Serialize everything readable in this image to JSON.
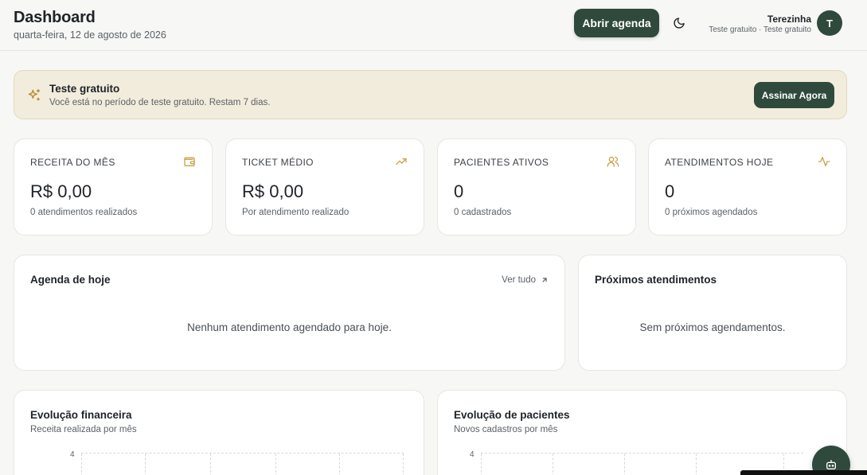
{
  "header": {
    "title": "Dashboard",
    "date": "quarta-feira, 12 de agosto de 2026",
    "agenda_button": "Abrir agenda",
    "theme_icon": "moon-icon",
    "user": {
      "name": "Terezinha",
      "plan": "Teste gratuito · Teste gratuito",
      "initial": "T"
    }
  },
  "trial_banner": {
    "icon": "sparkles-icon",
    "title": "Teste gratuito",
    "text": "Você está no período de teste gratuito. Restam 7 dias.",
    "button": "Assinar Agora"
  },
  "stats": [
    {
      "label": "RECEITA DO MÊS",
      "value": "R$ 0,00",
      "sub": "0 atendimentos realizados",
      "icon": "wallet-icon"
    },
    {
      "label": "TICKET MÉDIO",
      "value": "R$ 0,00",
      "sub": "Por atendimento realizado",
      "icon": "trending-up-icon"
    },
    {
      "label": "PACIENTES ATIVOS",
      "value": "0",
      "sub": "0 cadastrados",
      "icon": "users-icon"
    },
    {
      "label": "ATENDIMENTOS HOJE",
      "value": "0",
      "sub": "0 próximos agendados",
      "icon": "activity-icon"
    }
  ],
  "agenda_hoje": {
    "title": "Agenda de hoje",
    "link": "Ver tudo",
    "empty": "Nenhum atendimento agendado para hoje."
  },
  "proximos": {
    "title": "Próximos atendimentos",
    "empty": "Sem próximos agendamentos."
  },
  "evolucao_financeira": {
    "title": "Evolução financeira",
    "subtitle": "Receita realizada por mês",
    "y_tick_top": "4"
  },
  "evolucao_pacientes": {
    "title": "Evolução de pacientes",
    "subtitle": "Novos cadastros por mês",
    "y_tick_top": "4"
  },
  "colors": {
    "brand": "#2f4a3c",
    "accent_gold": "#c9a24a",
    "banner_bg": "#f2ecdc"
  }
}
